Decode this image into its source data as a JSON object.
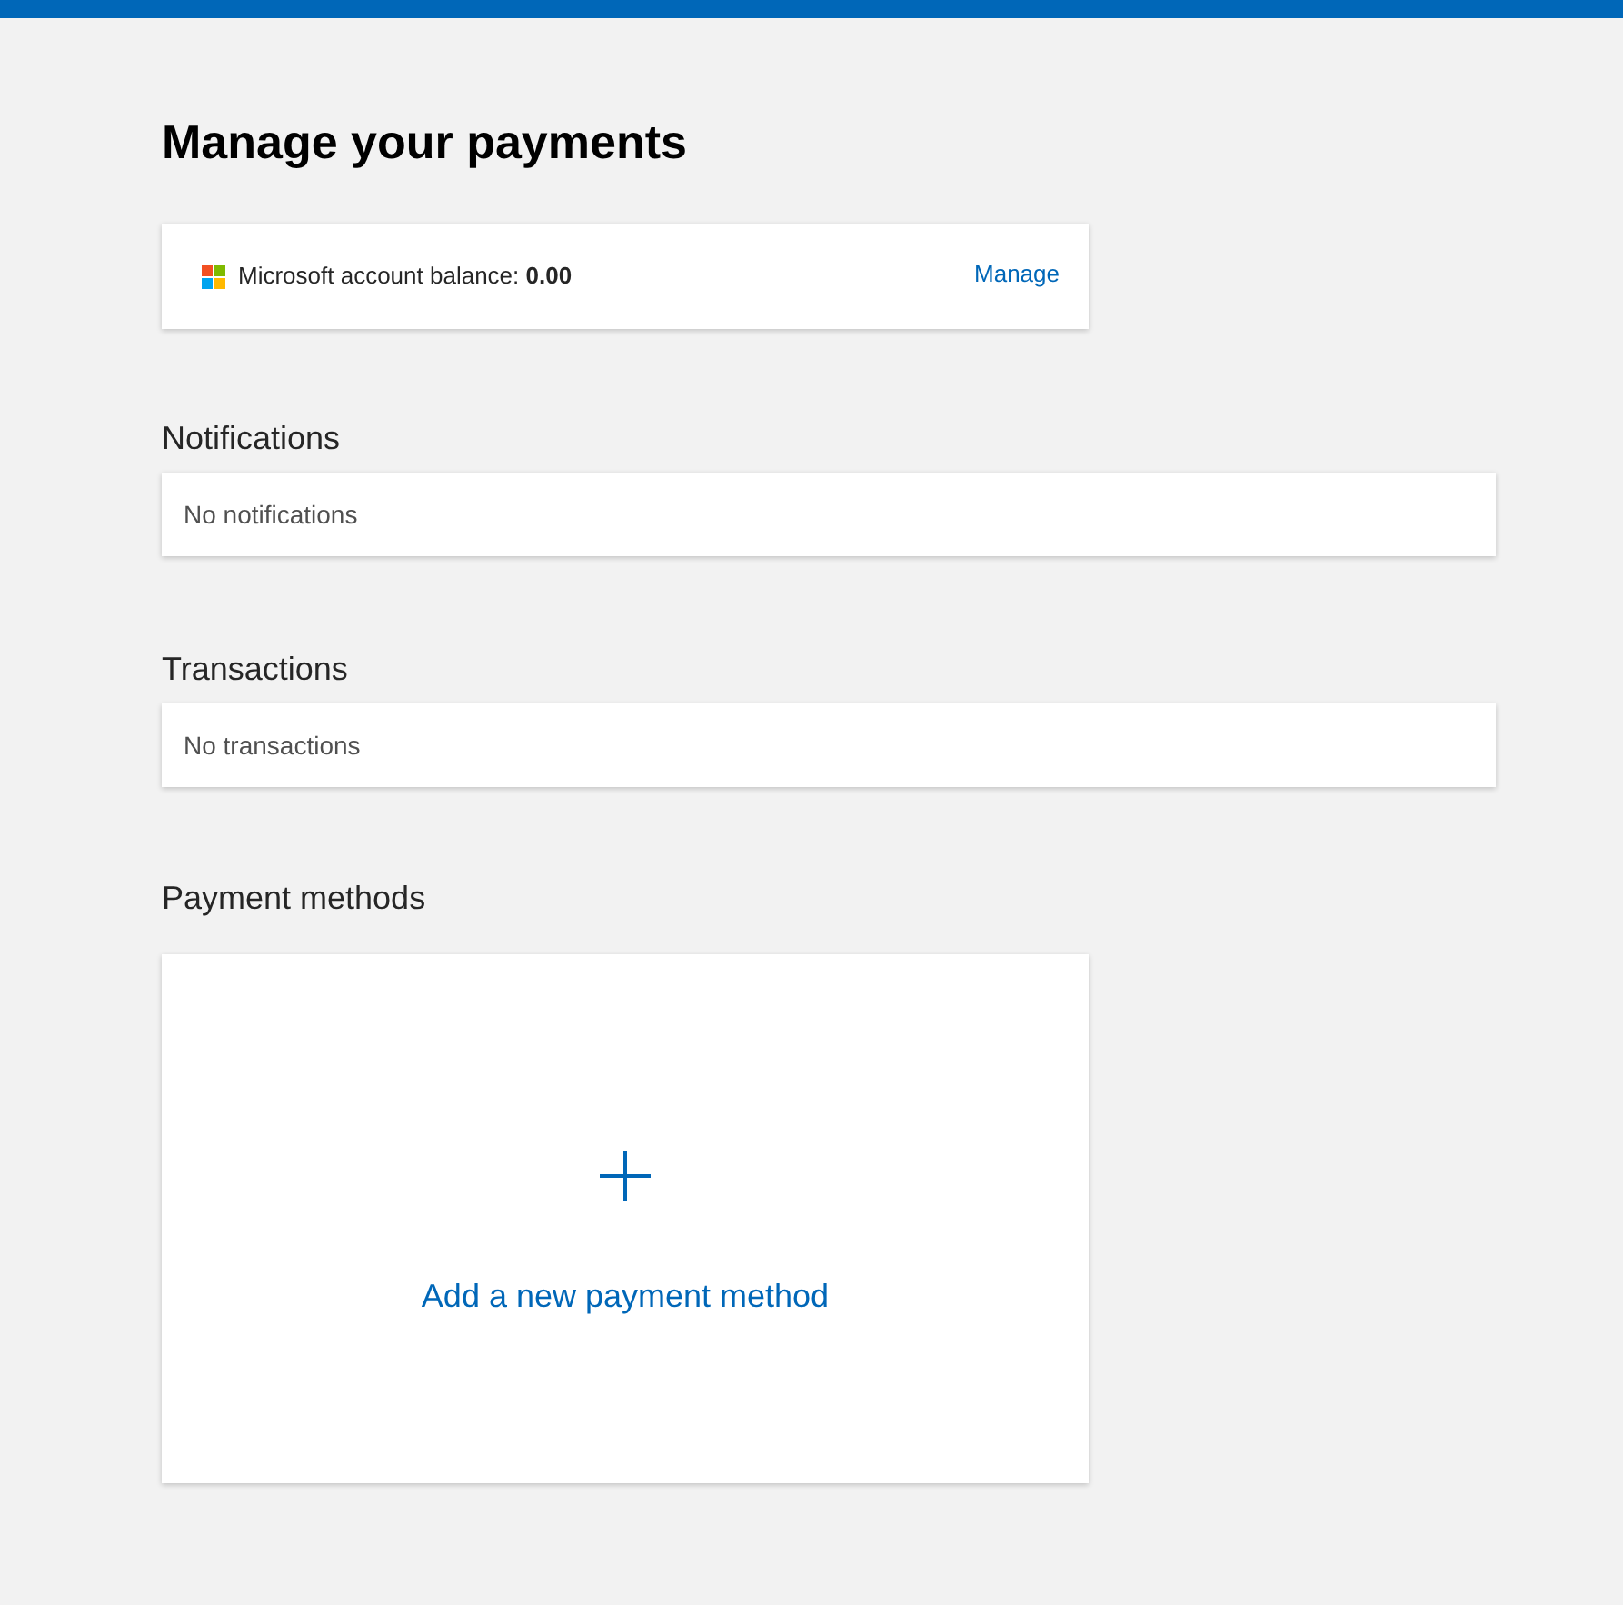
{
  "title": "Manage your payments",
  "balance": {
    "label": "Microsoft account balance: **0.00**",
    "link": "Manage"
  },
  "sections": [
    {
      "heading": "Notifications",
      "empty_text": "No notifications"
    },
    {
      "heading": "Transactions",
      "empty_text": "No transactions"
    }
  ],
  "payment_methods": {
    "heading": "Payment methods",
    "add_label": "Add a new payment method"
  }
}
